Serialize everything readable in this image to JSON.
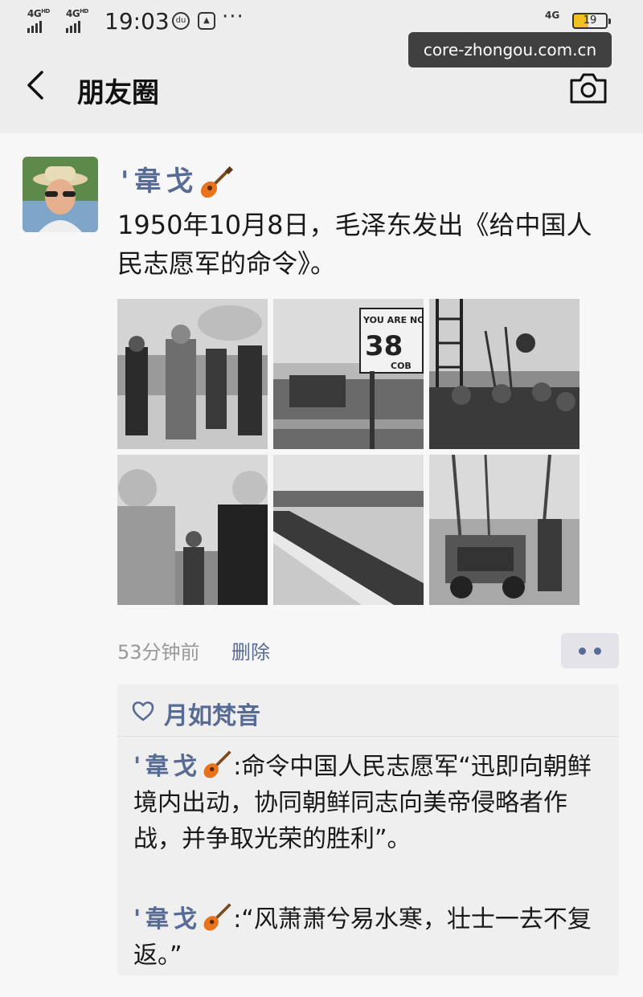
{
  "status_bar": {
    "network_1": "4G",
    "network_1_sup": "HD",
    "network_2": "4G",
    "network_2_sup": "HD",
    "time": "19:03",
    "network_right": "4G",
    "battery": "19"
  },
  "watermark": "core-zhongou.com.cn",
  "nav": {
    "title": "朋友圈"
  },
  "post": {
    "author_name": "'韋戈",
    "text": "1950年10月8日，毛泽东发出《给中国人民志愿军的命令》。",
    "photo_sign_line1": "YOU ARE NOW",
    "photo_sign_number": "38",
    "photo_sign_line2": "COB",
    "time_ago": "53分钟前",
    "delete_label": "删除"
  },
  "interactions": {
    "liker": "月如梵音",
    "comments": [
      {
        "author": "'韋戈",
        "text": ":命令中国人民志愿军“迅即向朝鲜境内出动，协同朝鲜同志向美帝侵略者作战，并争取光荣的胜利”。"
      },
      {
        "author": "'韋戈",
        "text": ":“风萧萧兮易水寒，壮士一去不复返。”"
      }
    ]
  },
  "colors": {
    "link_blue": "#576b95",
    "background": "#f7f7f7",
    "bar_gray": "#ededed"
  }
}
